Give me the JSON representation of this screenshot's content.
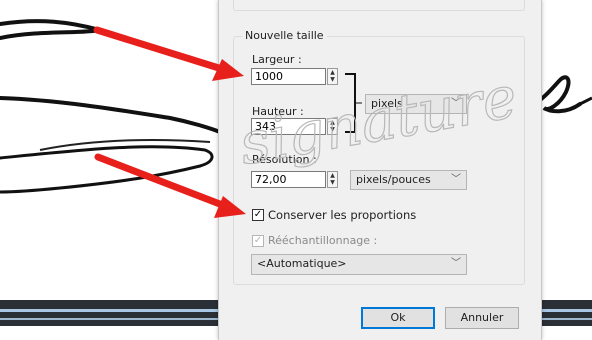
{
  "dialog": {
    "group_title": "Nouvelle taille",
    "width_label": "Largeur :",
    "width_value": "1000",
    "height_label": "Hauteur :",
    "height_value": "343",
    "units_select": "pixels",
    "resolution_label": "Résolution :",
    "resolution_value": "72,00",
    "resolution_units": "pixels/pouces",
    "keep_proportions_label": "Conserver les proportions",
    "keep_proportions_checked": true,
    "resample_label": "Rééchantillonnage :",
    "resample_checked": true,
    "resample_enabled": false,
    "resample_select": "<Automatique>",
    "ok_label": "Ok",
    "cancel_label": "Annuler"
  },
  "background": {
    "watermark_text": "signature"
  },
  "colors": {
    "arrow": "#e8201c",
    "dialog_bg": "#f0f0f0",
    "accent": "#0078d7"
  }
}
